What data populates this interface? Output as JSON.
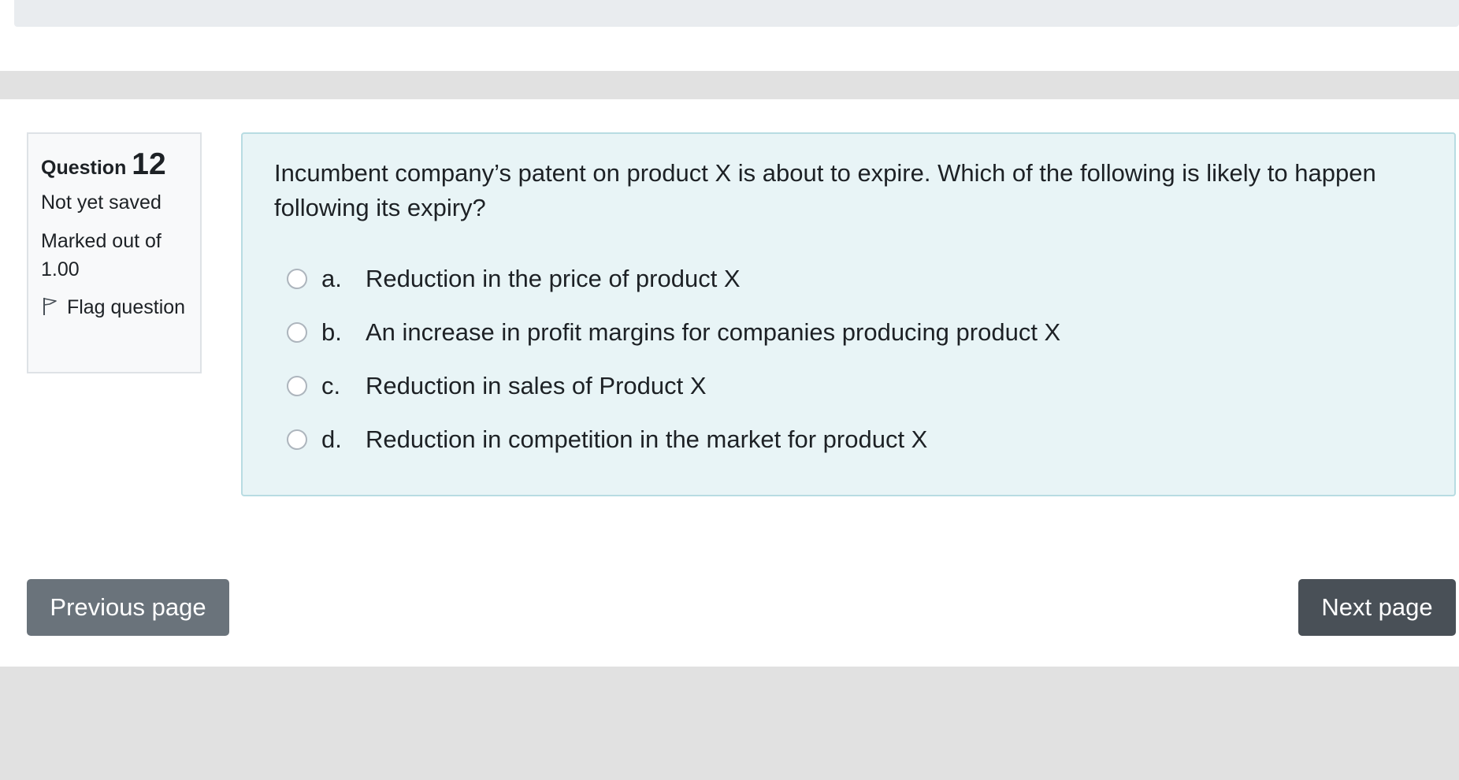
{
  "colors": {
    "content_bg": "#e8f4f6",
    "content_border": "#b8dce2",
    "info_bg": "#f8f9fa",
    "prev_button": "#6a737b",
    "next_button": "#495057",
    "band_gray": "#e1e1e1"
  },
  "question_info": {
    "label": "Question",
    "number": "12",
    "state": "Not yet saved",
    "grade": "Marked out of 1.00",
    "flag_label": "Flag question",
    "flag_icon": "flag-icon"
  },
  "question": {
    "text": "Incumbent company’s patent on product X is about to expire. Which of the following is likely to happen following its expiry?",
    "answers": [
      {
        "letter": "a.",
        "text": "Reduction in the price of product X"
      },
      {
        "letter": "b.",
        "text": "An increase in profit margins for companies producing product X"
      },
      {
        "letter": "c.",
        "text": "Reduction in sales of Product X"
      },
      {
        "letter": "d.",
        "text": "Reduction in competition in the market for product X"
      }
    ]
  },
  "navigation": {
    "previous_label": "Previous page",
    "next_label": "Next page"
  }
}
